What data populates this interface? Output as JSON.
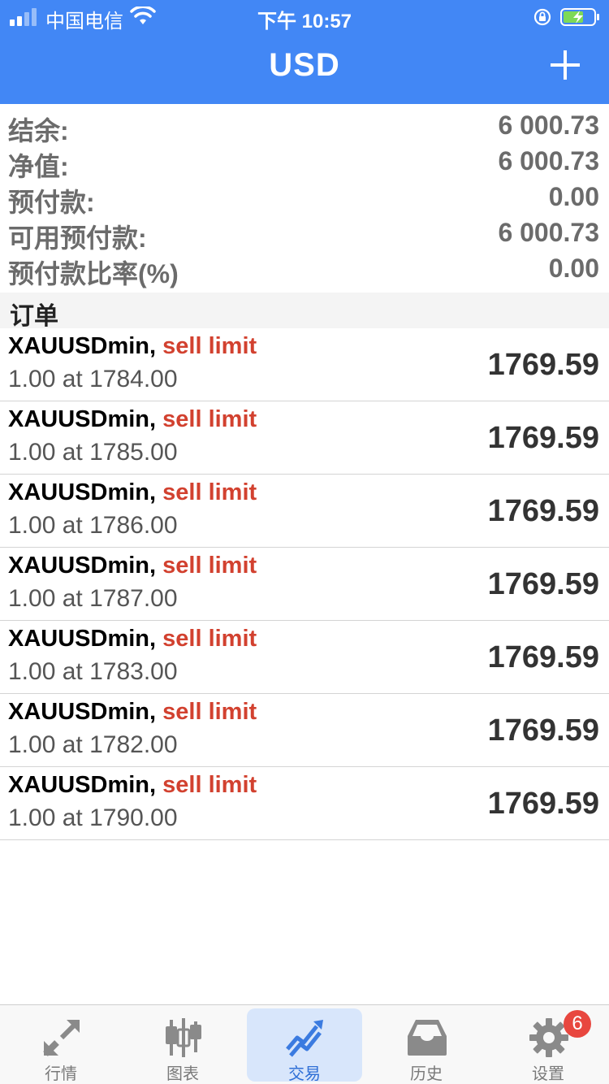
{
  "status_bar": {
    "carrier": "中国电信",
    "time": "下午 10:57"
  },
  "nav": {
    "title": "USD"
  },
  "summary": [
    {
      "label": "结余:",
      "value": "6 000.73"
    },
    {
      "label": "净值:",
      "value": "6 000.73"
    },
    {
      "label": "预付款:",
      "value": "0.00"
    },
    {
      "label": "可用预付款:",
      "value": "6 000.73"
    },
    {
      "label": "预付款比率(%)",
      "value": "0.00"
    }
  ],
  "orders_section": {
    "title": "订单"
  },
  "orders": [
    {
      "symbol": "XAUUSDmin,",
      "type": "sell limit",
      "detail": "1.00 at 1784.00",
      "price": "1769.59"
    },
    {
      "symbol": "XAUUSDmin,",
      "type": "sell limit",
      "detail": "1.00 at 1785.00",
      "price": "1769.59"
    },
    {
      "symbol": "XAUUSDmin,",
      "type": "sell limit",
      "detail": "1.00 at 1786.00",
      "price": "1769.59"
    },
    {
      "symbol": "XAUUSDmin,",
      "type": "sell limit",
      "detail": "1.00 at 1787.00",
      "price": "1769.59"
    },
    {
      "symbol": "XAUUSDmin,",
      "type": "sell limit",
      "detail": "1.00 at 1783.00",
      "price": "1769.59"
    },
    {
      "symbol": "XAUUSDmin,",
      "type": "sell limit",
      "detail": "1.00 at 1782.00",
      "price": "1769.59"
    },
    {
      "symbol": "XAUUSDmin,",
      "type": "sell limit",
      "detail": "1.00 at 1790.00",
      "price": "1769.59"
    }
  ],
  "tabs": [
    {
      "label": "行情",
      "icon": "quotes-arrows-icon",
      "active": false
    },
    {
      "label": "图表",
      "icon": "candlestick-chart-icon",
      "active": false
    },
    {
      "label": "交易",
      "icon": "trade-trend-icon",
      "active": true
    },
    {
      "label": "历史",
      "icon": "history-inbox-icon",
      "active": false
    },
    {
      "label": "设置",
      "icon": "settings-gear-icon",
      "active": false,
      "badge": "6"
    }
  ],
  "colors": {
    "accent": "#4287f5",
    "sell": "#d2412f",
    "badge": "#e8473f",
    "active_tab_bg": "#d8e6fb"
  }
}
